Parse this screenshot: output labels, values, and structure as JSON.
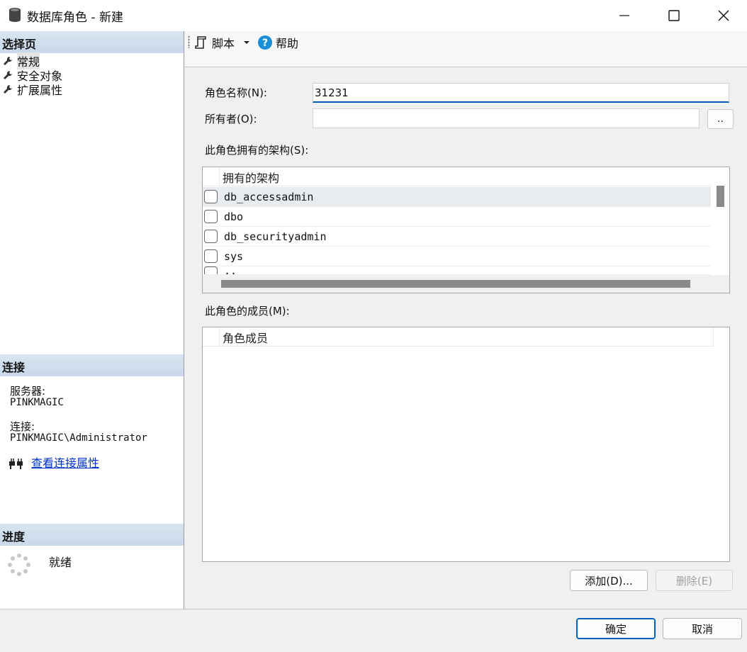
{
  "window": {
    "title": "数据库角色 - 新建"
  },
  "left": {
    "select_page_header": "选择页",
    "nav_items": [
      {
        "label": "常规",
        "icon": "wrench-icon"
      },
      {
        "label": "安全对象",
        "icon": "wrench-icon"
      },
      {
        "label": "扩展属性",
        "icon": "wrench-icon"
      }
    ],
    "connection_header": "连接",
    "server_label": "服务器:",
    "server_value": "PINKMAGIC",
    "connection_label": "连接:",
    "connection_value": "PINKMAGIC\\Administrator",
    "view_connection_link": "查看连接属性",
    "progress_header": "进度",
    "progress_status": "就绪"
  },
  "toolbar": {
    "script_label": "脚本",
    "help_label": "帮助"
  },
  "form": {
    "role_name_label": "角色名称(N):",
    "role_name_value": "31231",
    "owner_label": "所有者(O):",
    "owner_value": "",
    "browse_label": "..",
    "schemas_label": "此角色拥有的架构(S):",
    "schemas_header": "拥有的架构",
    "schemas": [
      {
        "name": "db_accessadmin",
        "checked": false
      },
      {
        "name": "dbo",
        "checked": false
      },
      {
        "name": "db_securityadmin",
        "checked": false
      },
      {
        "name": "sys",
        "checked": false
      },
      {
        "name": "..",
        "checked": false
      }
    ],
    "members_label": "此角色的成员(M):",
    "members_header": "角色成员",
    "add_label": "添加(D)...",
    "remove_label": "删除(E)"
  },
  "footer": {
    "ok_label": "确定",
    "cancel_label": "取消"
  },
  "colors": {
    "link": "#0033cc",
    "focus_accent": "#0060c0",
    "section_header": "#c9d9ea"
  }
}
